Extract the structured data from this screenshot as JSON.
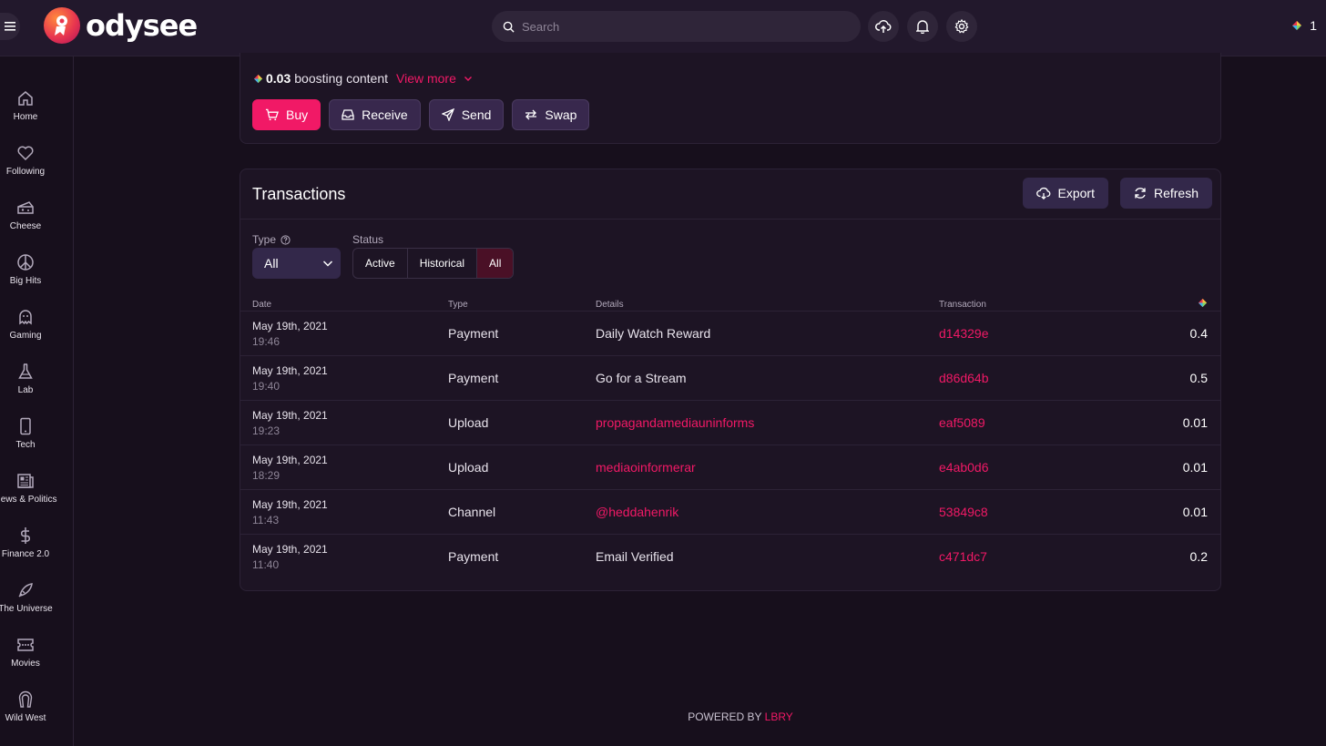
{
  "header": {
    "logo_text": "odysee",
    "search_placeholder": "Search",
    "balance": "1"
  },
  "sidebar": {
    "items": [
      {
        "label": "Home",
        "icon": "home-icon"
      },
      {
        "label": "Following",
        "icon": "heart-icon"
      },
      {
        "label": "Cheese",
        "icon": "cheese-icon"
      },
      {
        "label": "Big Hits",
        "icon": "peace-icon"
      },
      {
        "label": "Gaming",
        "icon": "ghost-icon"
      },
      {
        "label": "Lab",
        "icon": "flask-icon"
      },
      {
        "label": "Tech",
        "icon": "phone-icon"
      },
      {
        "label": "News & Politics",
        "icon": "newspaper-icon"
      },
      {
        "label": "Finance 2.0",
        "icon": "dollar-icon"
      },
      {
        "label": "The Universe",
        "icon": "rocket-icon"
      },
      {
        "label": "Movies",
        "icon": "ticket-icon"
      },
      {
        "label": "Wild West",
        "icon": "horseshoe-icon"
      }
    ]
  },
  "wallet": {
    "boost_amount": "0.03",
    "boost_text": "boosting content",
    "view_more": "View more",
    "buttons": {
      "buy": "Buy",
      "receive": "Receive",
      "send": "Send",
      "swap": "Swap"
    }
  },
  "transactions": {
    "title": "Transactions",
    "export_label": "Export",
    "refresh_label": "Refresh",
    "type_label": "Type",
    "type_value": "All",
    "status_label": "Status",
    "status_options": [
      "Active",
      "Historical",
      "All"
    ],
    "columns": {
      "date": "Date",
      "type": "Type",
      "details": "Details",
      "transaction": "Transaction"
    },
    "rows": [
      {
        "date": "May 19th, 2021",
        "time": "19:46",
        "type": "Payment",
        "details": "Daily Watch Reward",
        "details_link": false,
        "txid": "d14329e",
        "amount": "0.4"
      },
      {
        "date": "May 19th, 2021",
        "time": "19:40",
        "type": "Payment",
        "details": "Go for a Stream",
        "details_link": false,
        "txid": "d86d64b",
        "amount": "0.5"
      },
      {
        "date": "May 19th, 2021",
        "time": "19:23",
        "type": "Upload",
        "details": "propagandamediauninforms",
        "details_link": true,
        "txid": "eaf5089",
        "amount": "0.01"
      },
      {
        "date": "May 19th, 2021",
        "time": "18:29",
        "type": "Upload",
        "details": "mediaoinformerar",
        "details_link": true,
        "txid": "e4ab0d6",
        "amount": "0.01"
      },
      {
        "date": "May 19th, 2021",
        "time": "11:43",
        "type": "Channel",
        "details": "@heddahenrik",
        "details_link": true,
        "txid": "53849c8",
        "amount": "0.01"
      },
      {
        "date": "May 19th, 2021",
        "time": "11:40",
        "type": "Payment",
        "details": "Email Verified",
        "details_link": false,
        "txid": "c471dc7",
        "amount": "0.2"
      }
    ]
  },
  "footer": {
    "powered_by": "POWERED BY",
    "brand": "LBRY"
  }
}
